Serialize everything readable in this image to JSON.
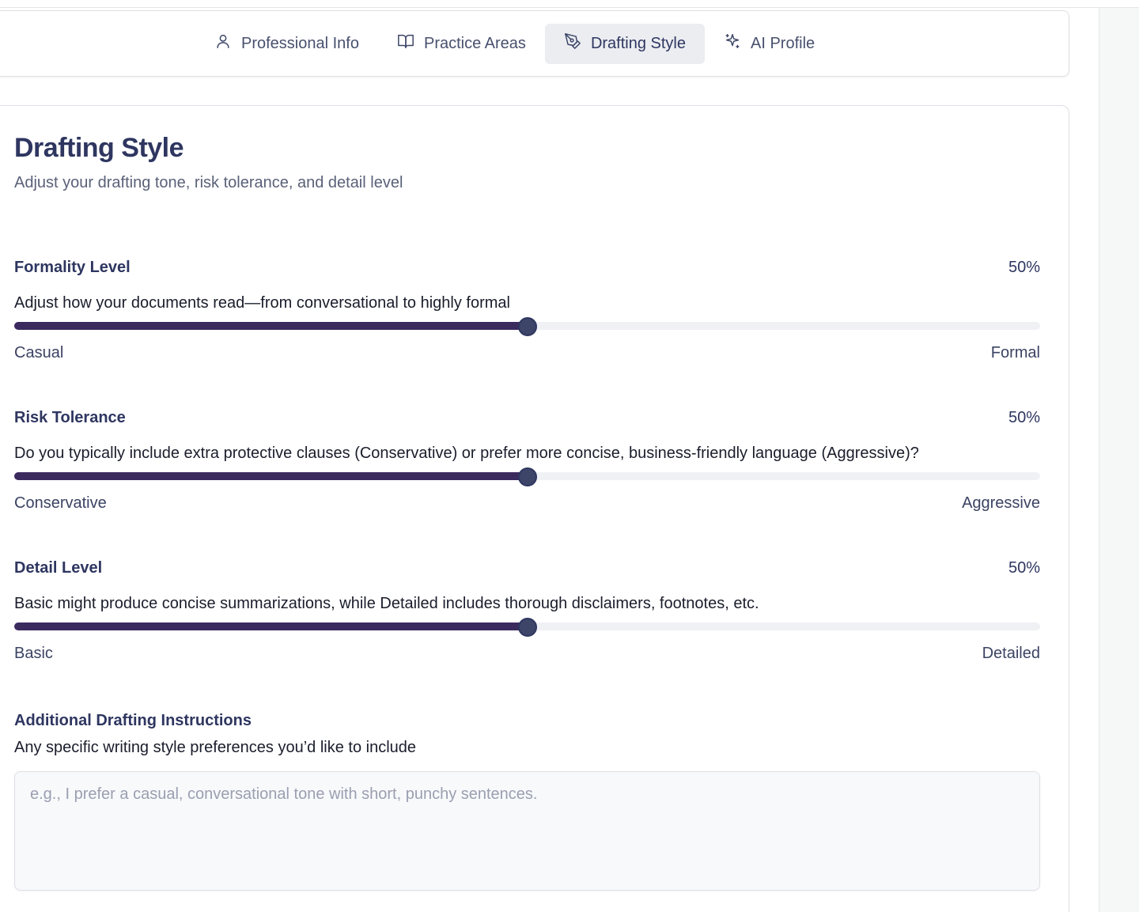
{
  "tabs": [
    {
      "label": "Professional Info",
      "icon": "user-icon",
      "active": false
    },
    {
      "label": "Practice Areas",
      "icon": "book-open-icon",
      "active": false
    },
    {
      "label": "Drafting Style",
      "icon": "pen-tool-icon",
      "active": true
    },
    {
      "label": "AI Profile",
      "icon": "sparkles-icon",
      "active": false
    }
  ],
  "section": {
    "title": "Drafting Style",
    "subtitle": "Adjust your drafting tone, risk tolerance, and detail level"
  },
  "sliders": [
    {
      "label": "Formality Level",
      "value_text": "50%",
      "value": 0.5,
      "description": "Adjust how your documents read—from conversational to highly formal",
      "min_label": "Casual",
      "max_label": "Formal"
    },
    {
      "label": "Risk Tolerance",
      "value_text": "50%",
      "value": 0.5,
      "description": "Do you typically include extra protective clauses (Conservative) or prefer more concise, business-friendly language (Aggressive)?",
      "min_label": "Conservative",
      "max_label": "Aggressive"
    },
    {
      "label": "Detail Level",
      "value_text": "50%",
      "value": 0.5,
      "description": "Basic might produce concise summarizations, while Detailed includes thorough disclaimers, footnotes, etc.",
      "min_label": "Basic",
      "max_label": "Detailed"
    }
  ],
  "instructions": {
    "label": "Additional Drafting Instructions",
    "description": "Any specific writing style preferences you’d like to include",
    "placeholder": "e.g., I prefer a casual, conversational tone with short, punchy sentences.",
    "value": ""
  },
  "colors": {
    "accent": "#3b2a5e",
    "heading": "#2e3660",
    "active_tab_bg": "#ebedf1"
  }
}
